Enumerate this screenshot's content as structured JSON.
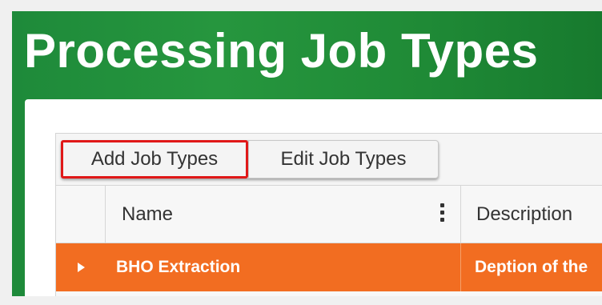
{
  "page": {
    "title": "Processing Job Types"
  },
  "toolbar": {
    "add_label": "Add Job Types",
    "edit_label": "Edit Job Types"
  },
  "columns": {
    "name": "Name",
    "description": "Description"
  },
  "rows": [
    {
      "name": "BHO Extraction",
      "description": "Deption of the"
    }
  ],
  "colors": {
    "header_green": "#1e8a3a",
    "selected_row": "#f26d21",
    "highlight_box": "#e01818"
  },
  "icons": {
    "column_menu": "kebab-icon",
    "row_expand": "caret-right-icon"
  }
}
